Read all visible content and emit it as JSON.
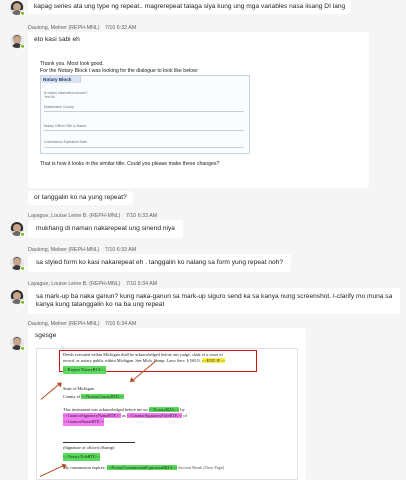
{
  "messages": [
    {
      "text": "kapag series ata ung type ng repeat.. magrerepeat talaga siya kung ung mga variables nasa iisang DI lang"
    },
    {
      "author": "Daulong, Melner (REPH-MNL)",
      "time": "7/10 6:32 AM",
      "text": "eto kasi sabi eh"
    },
    {
      "author": "",
      "time": "",
      "text": "or tanggalin ko na yung repeat?"
    },
    {
      "author": "Layague, Louise Leine B. (REPH-MNL)",
      "time": "7/10 6:33 AM",
      "text": "mukhang di naman nakarepeat ung sinend niya"
    },
    {
      "author": "Daulong, Melner (REPH-MNL)",
      "time": "7/10 6:33 AM",
      "text": "sa styled form ko kasi nakarepeat eh . tanggalin ko nalang sa form yung repeat noh?"
    },
    {
      "author": "Layague, Louise Leine B. (REPH-MNL)",
      "time": "7/10 6:34 AM",
      "text_line1": "sa mark-up ba naka ganun? kung naka-ganun sa mark-up siguro send ka sa kanya nung screenshot. I-clarify mo muna sa",
      "text_line2": "kanya kung tatanggalin ko na ba ung repeat"
    },
    {
      "author": "Daulong, Melner (REPH-MNL)",
      "time": "7/10 6:34 AM",
      "text": "sgesge"
    }
  ],
  "attachment1": {
    "line1": "Thank you. Most look good.",
    "line2": "For the Notary Block I was looking for the dialogue to look like below:",
    "header": "Notary Block",
    "q1": "Is notary information known?",
    "q1_opts": "Yes   No",
    "f1": "Notarization County:",
    "f2": "Notary Officer Title or Name:",
    "f3": "Commission Expiration Date:",
    "footer": "That is how it looks in the similar title. Could you please make these changes?"
  },
  "attachment2": {
    "l1": "Deeds executed within Michigan shall be acknowledged before any judge, clerk of a court of",
    "l2": "record, or notary public within Michigan. See Mich. Comp. Laws Serv. § 565.8.",
    "l2_tag": "<<END IF>>",
    "l3": "<<Repeat NotaryBLK>>",
    "l4": "State of Michigan",
    "l5a": "County of",
    "l5b": "<<NotaryCountyRTE>>",
    "l6a": "This instrument was acknowledged before me on",
    "l6b": "<<NotaryRDA>>",
    "l6c": "by",
    "l7a": "<<GrantorSignatoryNameRTE>>",
    "l7b": "as",
    "l7c": "<<GrantorSignatoryTitleRTE>>",
    "l7d": "of",
    "l8": "<<GrantorNameRTE>>",
    "l9": "(Signature of officer) (Stamp)",
    "l10": "<<NotaryTitleRTE>>",
    "l11a": "My commission expires:",
    "l11b": "<<NotaryCommissionExpirationRDA>>",
    "l11c": "Section Break (Next Page)"
  },
  "colors": {
    "presence": "#6bb700",
    "highlight_green": "#5cdc5c",
    "highlight_yellow": "#fff24a",
    "highlight_magenta": "#f47cf4",
    "arrow": "#b5481c"
  }
}
